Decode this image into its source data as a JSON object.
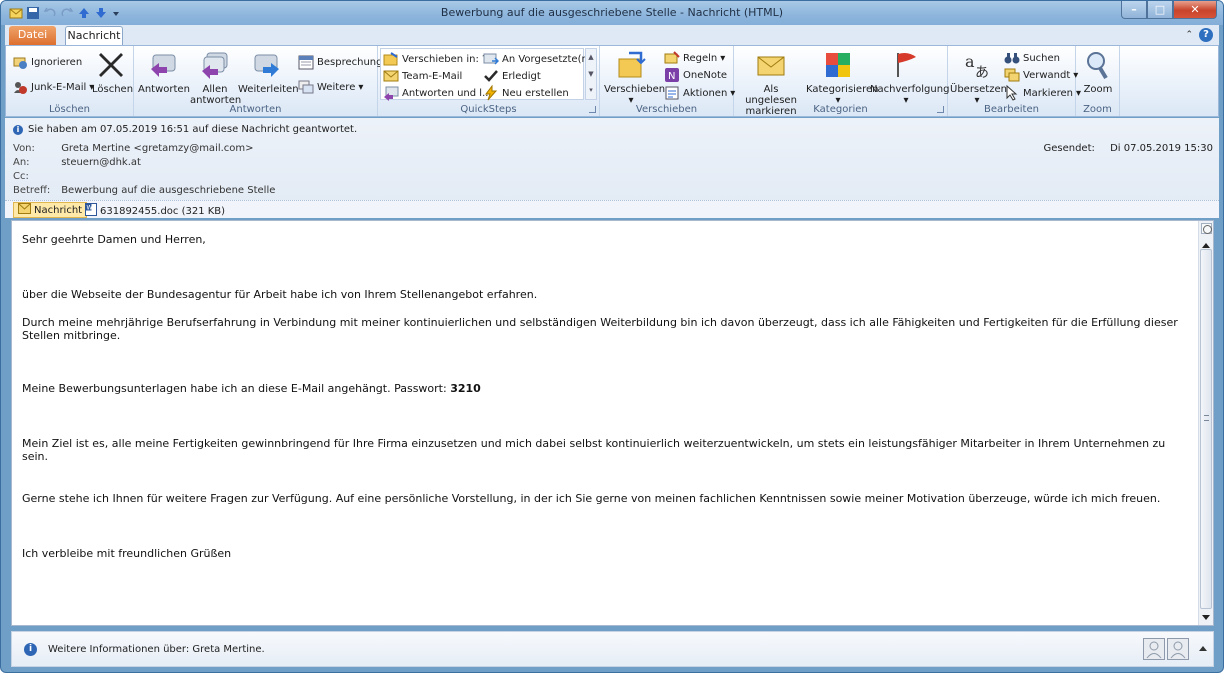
{
  "window": {
    "title": "Bewerbung auf die ausgeschriebene Stelle - Nachricht (HTML)"
  },
  "tabs": {
    "file": "Datei",
    "message": "Nachricht"
  },
  "ribbon": {
    "loeschen": {
      "label": "Löschen",
      "ignore": "Ignorieren",
      "junk": "Junk-E-Mail",
      "delete": "Löschen"
    },
    "antworten": {
      "label": "Antworten",
      "reply": "Antworten",
      "reply_all_1": "Allen",
      "reply_all_2": "antworten",
      "forward": "Weiterleiten",
      "meeting": "Besprechung",
      "more": "Weitere"
    },
    "quicksteps": {
      "label": "QuickSteps",
      "move_to": "Verschieben in: ?",
      "to_manager": "An Vorgesetzte(n)",
      "team_mail": "Team-E-Mail",
      "done": "Erledigt",
      "reply_delete": "Antworten und l...",
      "create_new": "Neu erstellen"
    },
    "verschieben": {
      "label": "Verschieben",
      "move": "Verschieben",
      "rules": "Regeln",
      "onenote": "OneNote",
      "actions": "Aktionen"
    },
    "kategorien": {
      "label": "Kategorien",
      "mark_unread_1": "Als ungelesen",
      "mark_unread_2": "markieren",
      "categorize": "Kategorisieren",
      "followup": "Nachverfolgung"
    },
    "bearbeiten": {
      "label": "Bearbeiten",
      "translate": "Übersetzen",
      "find": "Suchen",
      "related": "Verwandt",
      "select": "Markieren"
    },
    "zoom": {
      "label": "Zoom",
      "zoom": "Zoom"
    }
  },
  "header": {
    "info": "Sie haben am 07.05.2019 16:51 auf diese Nachricht geantwortet.",
    "from_label": "Von:",
    "from": "Greta Mertine <gretamzy@mail.com>",
    "to_label": "An:",
    "to": "steuern@dhk.at",
    "cc_label": "Cc:",
    "cc": "",
    "subject_label": "Betreff:",
    "subject": "Bewerbung auf die ausgeschriebene Stelle",
    "sent_label": "Gesendet:",
    "sent": "Di 07.05.2019 15:30"
  },
  "attachments": {
    "message_tab": "Nachricht",
    "file": "631892455.doc (321 KB)"
  },
  "body": {
    "greeting": "Sehr geehrte Damen und Herren,",
    "p1": "über die Webseite der Bundesagentur für Arbeit habe ich von Ihrem Stellenangebot erfahren.",
    "p2": "Durch meine mehrjährige Berufserfahrung in Verbindung mit meiner kontinuierlichen und selbständigen Weiterbildung bin ich davon überzeugt, dass ich alle Fähigkeiten und Fertigkeiten für die Erfüllung dieser Stellen mitbringe.",
    "p3_text": "Meine Bewerbungsunterlagen habe ich an diese E-Mail angehängt. Passwort: ",
    "p3_password": "3210",
    "p4": "Mein Ziel ist es, alle meine Fertigkeiten gewinnbringend für Ihre Firma einzusetzen und mich dabei selbst kontinuierlich weiterzuentwickeln, um stets ein leistungsfähiger Mitarbeiter in Ihrem Unternehmen zu sein.",
    "p5": "Gerne stehe ich Ihnen für weitere Fragen zur Verfügung. Auf eine persönliche Vorstellung, in der ich Sie gerne von meinen fachlichen Kenntnissen sowie meiner Motivation überzeuge, würde ich mich freuen.",
    "closing": "Ich verbleibe mit freundlichen Grüßen"
  },
  "people_pane": {
    "text": "Weitere Informationen über: Greta Mertine."
  }
}
